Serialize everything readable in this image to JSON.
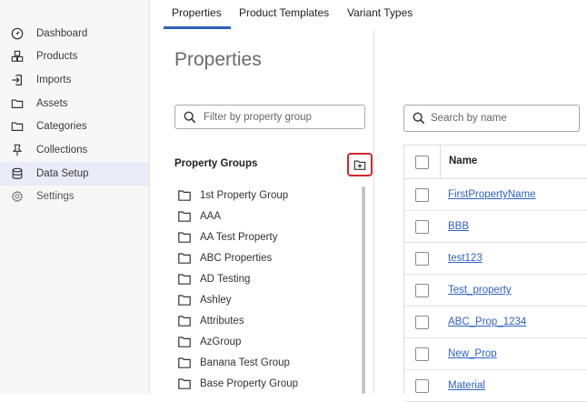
{
  "sidebar": {
    "items": [
      {
        "label": "Dashboard",
        "icon": "dashboard-icon"
      },
      {
        "label": "Products",
        "icon": "products-icon"
      },
      {
        "label": "Imports",
        "icon": "import-icon"
      },
      {
        "label": "Assets",
        "icon": "folder-icon"
      },
      {
        "label": "Categories",
        "icon": "folder-icon"
      },
      {
        "label": "Collections",
        "icon": "pin-icon"
      },
      {
        "label": "Data Setup",
        "icon": "database-icon",
        "active": true
      },
      {
        "label": "Settings",
        "icon": "gear-icon"
      }
    ]
  },
  "tabs": [
    {
      "label": "Properties",
      "active": true
    },
    {
      "label": "Product Templates"
    },
    {
      "label": "Variant Types"
    }
  ],
  "left_panel": {
    "title": "Properties",
    "filter_placeholder": "Filter by property group",
    "groups_heading": "Property Groups",
    "groups": [
      "1st Property Group",
      "AAA",
      "AA Test Property",
      "ABC Properties",
      "AD Testing",
      "Ashley",
      "Attributes",
      "AzGroup",
      "Banana Test Group",
      "Base Property Group"
    ]
  },
  "right_panel": {
    "search_placeholder": "Search by name",
    "column_name": "Name",
    "rows": [
      "FirstPropertyName",
      "BBB",
      "test123",
      "Test_property",
      "ABC_Prop_1234",
      "New_Prop",
      "Material"
    ]
  },
  "colors": {
    "accent": "#2c5fb8",
    "highlight_border": "#d6252b",
    "link": "#2f62c6",
    "sidebar_active_bg": "#e9ebf7"
  }
}
